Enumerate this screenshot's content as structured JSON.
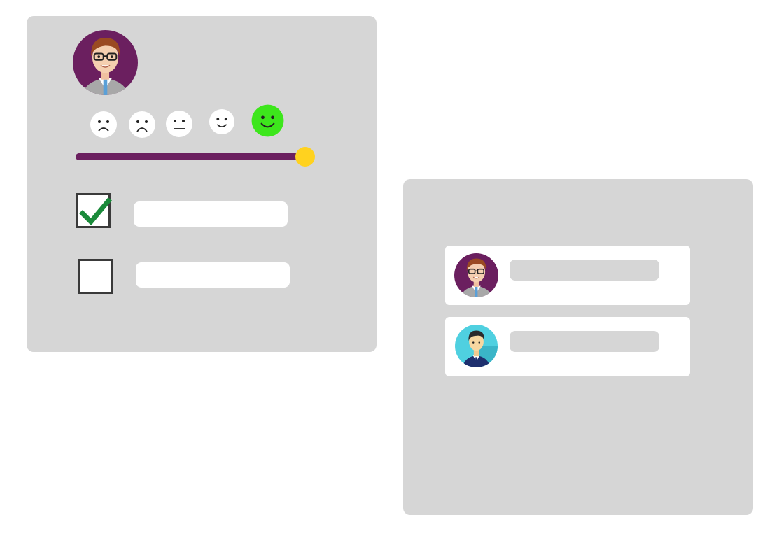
{
  "feedback_card": {
    "user": {
      "avatar_icon": "woman-with-glasses-avatar-icon"
    },
    "ratings": [
      {
        "icon": "very-sad-face-icon",
        "selected": false
      },
      {
        "icon": "sad-face-icon",
        "selected": false
      },
      {
        "icon": "neutral-face-icon",
        "selected": false
      },
      {
        "icon": "slight-smile-face-icon",
        "selected": false
      },
      {
        "icon": "happy-face-icon",
        "selected": true
      }
    ],
    "slider": {
      "value_fraction": 1.0
    },
    "options": [
      {
        "checked": true,
        "value": ""
      },
      {
        "checked": false,
        "value": ""
      }
    ]
  },
  "contacts_card": {
    "contacts": [
      {
        "avatar_icon": "woman-with-glasses-avatar-icon",
        "name": ""
      },
      {
        "avatar_icon": "man-in-suit-avatar-icon",
        "name": ""
      }
    ]
  },
  "colors": {
    "card_bg": "#d6d6d6",
    "slider_fill": "#6b1f5f",
    "slider_thumb": "#ffd21f",
    "selected_emoji": "#3de61c",
    "check": "#1a8a3a",
    "avatar_purple": "#6b1f5f",
    "avatar_cyan": "#4fd0e0"
  }
}
